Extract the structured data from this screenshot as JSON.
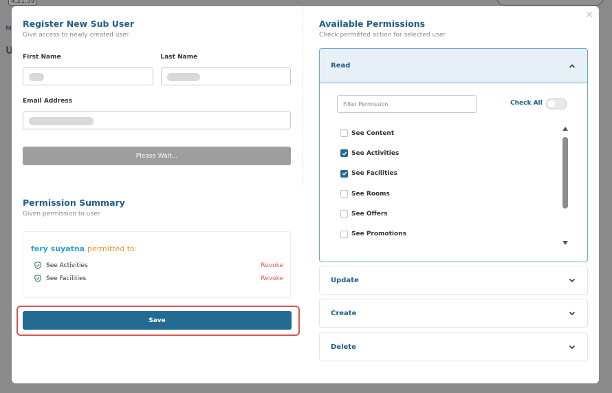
{
  "background": {
    "version": "4.21.59",
    "letter_m": "M",
    "letter_u": "U"
  },
  "left": {
    "title": "Register New Sub User",
    "subtitle": "Give access to newly created user",
    "first_name_label": "First Name",
    "last_name_label": "Last Name",
    "email_label": "Email Address",
    "wait_button": "Please Wait..."
  },
  "summary": {
    "title": "Permission Summary",
    "subtitle": "Given permission to user",
    "user_name": "fery suyatna",
    "permitted_to": "permitted to:",
    "items": [
      {
        "label": "See Activities",
        "action": "Revoke"
      },
      {
        "label": "See Facilities",
        "action": "Revoke"
      }
    ]
  },
  "save_button": "Save",
  "right": {
    "title": "Available Permissions",
    "subtitle": "Check permitted action for selected user",
    "read": {
      "label": "Read",
      "filter_placeholder": "Filter Permission",
      "check_all": "Check All",
      "items": [
        {
          "label": "See Content",
          "checked": false
        },
        {
          "label": "See Activities",
          "checked": true
        },
        {
          "label": "See Facilities",
          "checked": true
        },
        {
          "label": "See Rooms",
          "checked": false
        },
        {
          "label": "See Offers",
          "checked": false
        },
        {
          "label": "See Promotions",
          "checked": false
        }
      ]
    },
    "update": "Update",
    "create": "Create",
    "delete": "Delete"
  },
  "colors": {
    "primary": "#236b93",
    "title": "#1d5f86",
    "user_name": "#2a9fd6",
    "permitted": "#e39a2f",
    "revoke": "#e05a4f",
    "highlight": "#d9534f"
  }
}
